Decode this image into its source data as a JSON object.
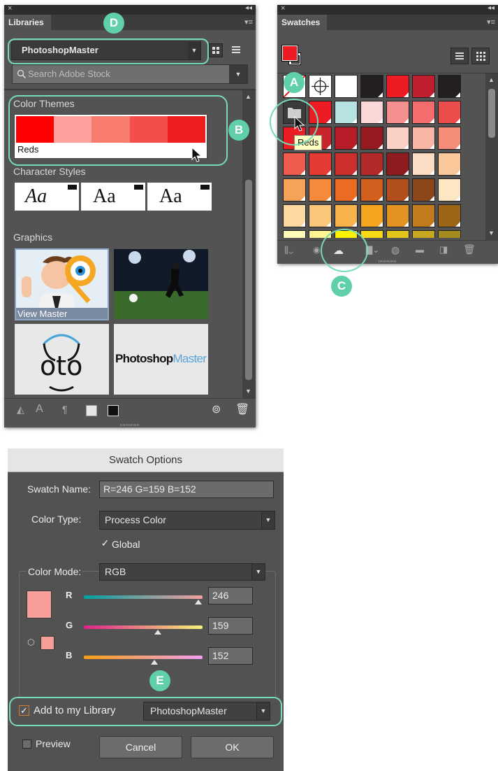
{
  "colors": {
    "accent": "#5fd0aa",
    "panel_bg": "#535353",
    "dialog_bg": "#525252"
  },
  "annotations": {
    "a": "A",
    "b": "B",
    "c": "C",
    "d": "D",
    "e": "E"
  },
  "libraries_panel": {
    "close_icon": "×",
    "collapse_icon": "◂◂",
    "menu_icon": "▾≡",
    "tab_label": "Libraries",
    "library_name": "PhotoshopMaster",
    "search_placeholder": "Search Adobe Stock",
    "color_themes": {
      "heading": "Color Themes",
      "name": "Reds",
      "colors": [
        "#fe0000",
        "#fca19c",
        "#f77c6d",
        "#f24e4b",
        "#ef1e1e"
      ]
    },
    "character_styles": {
      "heading": "Character Styles",
      "samples": [
        "Aa",
        "Aa",
        "Aa"
      ]
    },
    "graphics": {
      "heading": "Graphics",
      "items": [
        {
          "label": "View Master",
          "icon": "view-master-cartoon"
        },
        {
          "label": "",
          "icon": "soccer-player-photo"
        },
        {
          "label": "oto",
          "icon": "oto-logo"
        },
        {
          "label_main": "Photoshop",
          "label_accent": "Master",
          "icon": "photoshopmaster-logo"
        }
      ]
    }
  },
  "swatches_panel": {
    "close_icon": "×",
    "collapse_icon": "◂◂",
    "menu_icon": "▾≡",
    "tab_label": "Swatches",
    "tooltip": "Reds",
    "rows": [
      [
        "none",
        "registration",
        "#ffffff",
        "#231f20",
        "#ed1c24",
        "#be1e2d",
        "#231f20"
      ],
      [
        "folder",
        "#ed1c24",
        "#b6e2e2",
        "#fcd7d7",
        "#f4908e",
        "#f26d6b",
        "#eb4d4d"
      ],
      [
        "#ec1c24",
        "#c9252d",
        "#b71d29",
        "#961b21",
        "#fbd0c6",
        "#f9b5a3",
        "#f58d78"
      ],
      [
        "#ef5b4f",
        "#e63b34",
        "#cd2f2c",
        "#b32a2a",
        "#8e1b1e",
        "#fcdcc3",
        "#f9c79a"
      ],
      [
        "#f6a35a",
        "#f48a3a",
        "#ee6b24",
        "#d15f1e",
        "#b34f1c",
        "#8b461b",
        "#fde6c2"
      ],
      [
        "#fdd9a0",
        "#fbc77a",
        "#f9b34c",
        "#f5a51f",
        "#e39322",
        "#c17b1c",
        "#9d6516"
      ],
      [
        "#fffbb8",
        "#fff48f",
        "#fff200",
        "#f7d917",
        "#e3c41b",
        "#c7a71f",
        "#a58a1d"
      ]
    ]
  },
  "swatch_options": {
    "title": "Swatch Options",
    "name_label": "Swatch Name:",
    "name_value": "R=246 G=159 B=152",
    "type_label": "Color Type:",
    "type_value": "Process Color",
    "global_label": "Global",
    "global_checked": true,
    "mode_label": "Color Mode:",
    "mode_value": "RGB",
    "preview_color": "#f69f98",
    "channels": [
      {
        "label": "R",
        "value": "246",
        "fraction": 0.965
      },
      {
        "label": "G",
        "value": "159",
        "fraction": 0.624
      },
      {
        "label": "B",
        "value": "152",
        "fraction": 0.596
      }
    ],
    "library_label": "Add to my Library",
    "library_checked": true,
    "library_value": "PhotoshopMaster",
    "preview_label": "Preview",
    "cancel_label": "Cancel",
    "ok_label": "OK"
  }
}
